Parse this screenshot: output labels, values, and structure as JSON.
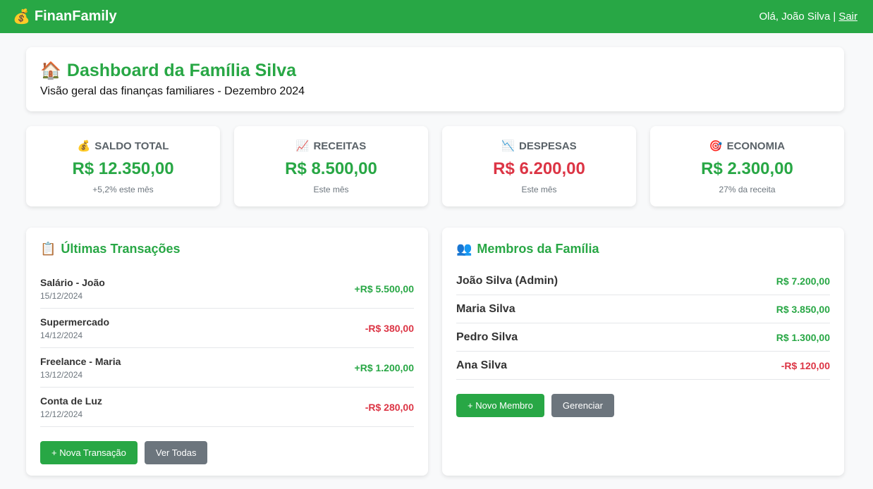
{
  "topbar": {
    "brand_icon": "💰",
    "brand": "FinanFamily",
    "greeting": "Olá, João Silva",
    "separator": "|",
    "logout": "Sair"
  },
  "header": {
    "icon": "🏠",
    "title": "Dashboard da Família Silva",
    "subtitle": "Visão geral das finanças familiares - Dezembro 2024"
  },
  "stats": [
    {
      "icon": "💰",
      "label": "SALDO TOTAL",
      "value": "R$ 12.350,00",
      "note": "+5,2% este mês",
      "color": "#28a745"
    },
    {
      "icon": "📈",
      "label": "RECEITAS",
      "value": "R$ 8.500,00",
      "note": "Este mês",
      "color": "#28a745"
    },
    {
      "icon": "📉",
      "label": "DESPESAS",
      "value": "R$ 6.200,00",
      "note": "Este mês",
      "color": "#dc3545"
    },
    {
      "icon": "🎯",
      "label": "ECONOMIA",
      "value": "R$ 2.300,00",
      "note": "27% da receita",
      "color": "#28a745"
    }
  ],
  "transactions": {
    "icon": "📋",
    "title": "Últimas Transações",
    "items": [
      {
        "name": "Salário - João",
        "date": "15/12/2024",
        "amount": "+R$ 5.500,00",
        "type": "pos"
      },
      {
        "name": "Supermercado",
        "date": "14/12/2024",
        "amount": "-R$ 380,00",
        "type": "neg"
      },
      {
        "name": "Freelance - Maria",
        "date": "13/12/2024",
        "amount": "+R$ 1.200,00",
        "type": "pos"
      },
      {
        "name": "Conta de Luz",
        "date": "12/12/2024",
        "amount": "-R$ 280,00",
        "type": "neg"
      }
    ],
    "buttons": {
      "new": "+ Nova Transação",
      "all": "Ver Todas"
    }
  },
  "members": {
    "icon": "👥",
    "title": "Membros da Família",
    "items": [
      {
        "name": "João Silva (Admin)",
        "amount": "R$ 7.200,00",
        "type": "pos"
      },
      {
        "name": "Maria Silva",
        "amount": "R$ 3.850,00",
        "type": "pos"
      },
      {
        "name": "Pedro Silva",
        "amount": "R$ 1.300,00",
        "type": "pos"
      },
      {
        "name": "Ana Silva",
        "amount": "-R$ 120,00",
        "type": "neg"
      }
    ],
    "buttons": {
      "new": "+ Novo Membro",
      "manage": "Gerenciar"
    }
  }
}
